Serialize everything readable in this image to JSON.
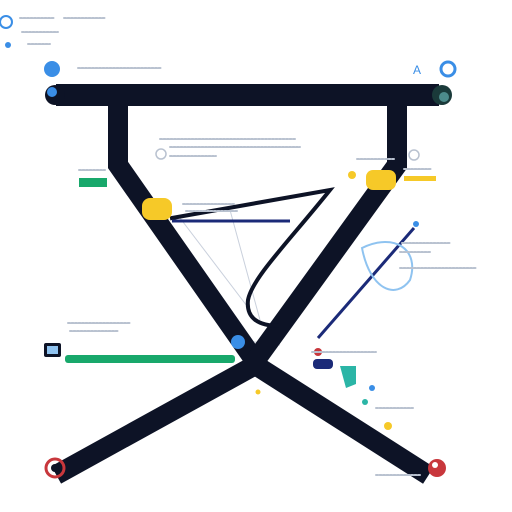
{
  "colors": {
    "background": "#ffffff",
    "frame": "#0d1326",
    "navy": "#1b2a78",
    "yellow": "#f6c928",
    "blue": "#3a8ee6",
    "green": "#18a86b",
    "teal": "#2bb5a6",
    "red": "#c8373c",
    "light_blue": "#8fc3f0",
    "text_placeholder": "#b9c2d0",
    "text_placeholder_dark": "#7f8aa0"
  },
  "icons": [
    "info-icon-top-left",
    "blue-dot-icon",
    "globe-icon",
    "user-outline-icon",
    "camera-icon",
    "red-drop-icon",
    "red-orb-icon",
    "droplet-icon",
    "pin-icon",
    "cloud-icon"
  ]
}
